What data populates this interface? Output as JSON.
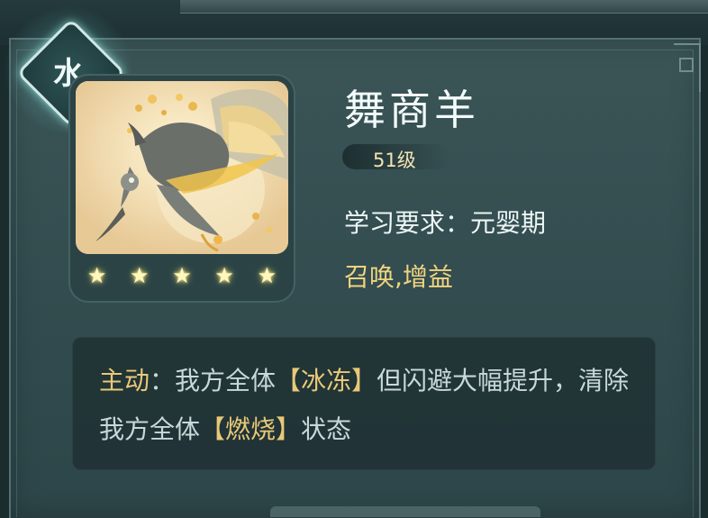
{
  "element_badge": {
    "char": "水",
    "icon": "water-element-diamond"
  },
  "skill": {
    "name": "舞商羊",
    "level": "51级",
    "requirement": "学习要求：元婴期",
    "tags": "召唤,增益",
    "stars": 5
  },
  "description": {
    "parts": [
      {
        "text": "主动",
        "style": "hl"
      },
      {
        "text": "：我方全体",
        "style": "normal"
      },
      {
        "text": "【冰冻】",
        "style": "hl"
      },
      {
        "text": "但闪避大幅提升，清除我方全体",
        "style": "normal"
      },
      {
        "text": "【燃烧】",
        "style": "hl"
      },
      {
        "text": "状态",
        "style": "normal"
      }
    ]
  },
  "colors": {
    "accent_gold": "#e9c978",
    "tag_gold": "#f0d47e",
    "panel": "#3b5557"
  }
}
